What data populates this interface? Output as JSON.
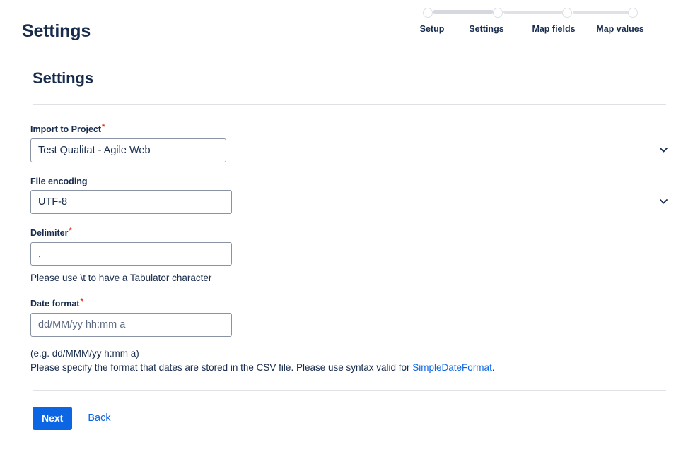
{
  "header": {
    "title": "Settings"
  },
  "stepper": {
    "steps": [
      {
        "label": "Setup"
      },
      {
        "label": "Settings"
      },
      {
        "label": "Map fields"
      },
      {
        "label": "Map values"
      }
    ]
  },
  "main": {
    "section_title": "Settings",
    "fields": {
      "project": {
        "label": "Import to Project",
        "required_marker": "*",
        "value": "Test Qualitat - Agile Web"
      },
      "encoding": {
        "label": "File encoding",
        "value": "UTF-8"
      },
      "delimiter": {
        "label": "Delimiter",
        "required_marker": "*",
        "value": ",",
        "hint": "Please use \\t to have a Tabulator character"
      },
      "dateformat": {
        "label": "Date format",
        "required_marker": "*",
        "value": "dd/MM/yy hh:mm a",
        "hint_example": "(e.g. dd/MMM/yy h:mm a)",
        "hint_prefix": "Please specify the format that dates are stored in the CSV file. Please use syntax valid for ",
        "hint_link": "SimpleDateFormat",
        "hint_suffix": "."
      }
    }
  },
  "actions": {
    "next_label": "Next",
    "back_label": "Back"
  },
  "colors": {
    "accent": "#0c66e4",
    "text": "#172b4d",
    "required": "#de350b",
    "border": "#8993a4",
    "divider": "#dfe1e6"
  }
}
